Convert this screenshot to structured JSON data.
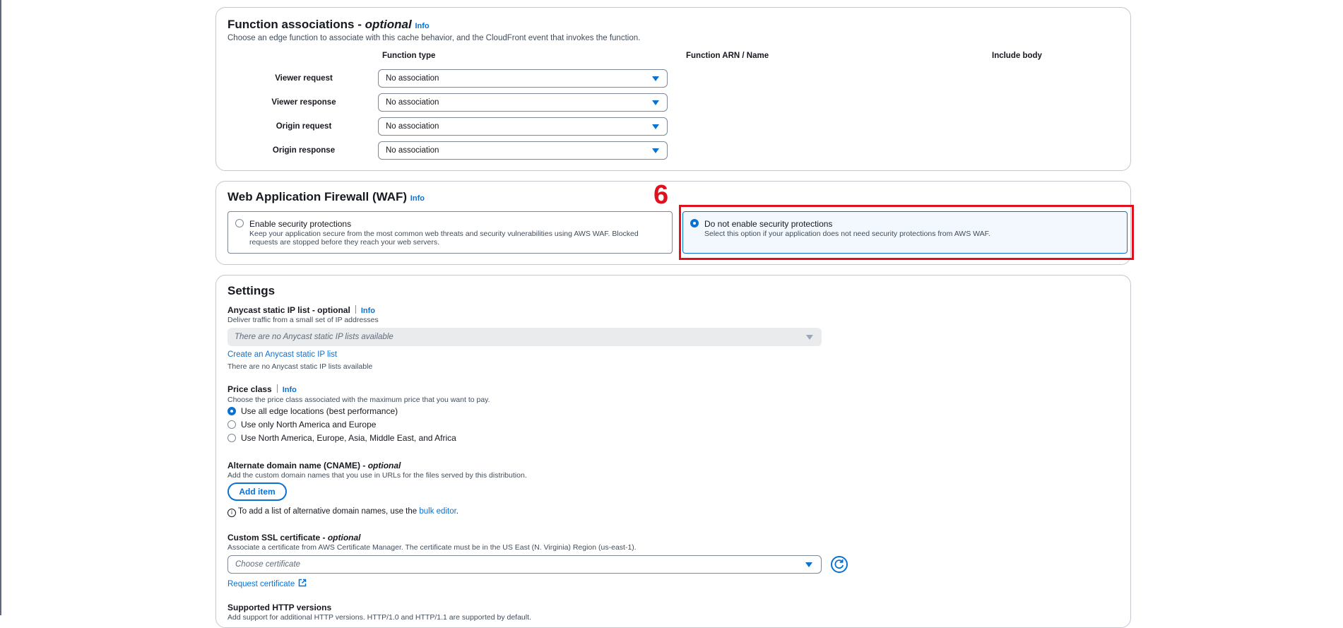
{
  "function_associations": {
    "title": "Function associations -",
    "title_optional": "optional",
    "info": "Info",
    "description": "Choose an edge function to associate with this cache behavior, and the CloudFront event that invokes the function.",
    "col_function_type": "Function type",
    "col_function_arn": "Function ARN / Name",
    "col_include_body": "Include body",
    "rows": [
      {
        "label": "Viewer request",
        "value": "No association"
      },
      {
        "label": "Viewer response",
        "value": "No association"
      },
      {
        "label": "Origin request",
        "value": "No association"
      },
      {
        "label": "Origin response",
        "value": "No association"
      }
    ]
  },
  "waf": {
    "title": "Web Application Firewall (WAF)",
    "info": "Info",
    "options": [
      {
        "title": "Enable security protections",
        "description": "Keep your application secure from the most common web threats and security vulnerabilities using AWS WAF. Blocked requests are stopped before they reach your web servers.",
        "selected": false
      },
      {
        "title": "Do not enable security protections",
        "description": "Select this option if your application does not need security protections from AWS WAF.",
        "selected": true
      }
    ]
  },
  "annotation": {
    "number": "6",
    "color": "#e0111c"
  },
  "settings": {
    "title": "Settings",
    "anycast": {
      "label": "Anycast static IP list - optional",
      "info": "Info",
      "description": "Deliver traffic from a small set of IP addresses",
      "placeholder": "There are no Anycast static IP lists available",
      "create_link": "Create an Anycast static IP list",
      "note": "There are no Anycast static IP lists available"
    },
    "price_class": {
      "label": "Price class",
      "info": "Info",
      "description": "Choose the price class associated with the maximum price that you want to pay.",
      "options": [
        {
          "label": "Use all edge locations (best performance)",
          "selected": true
        },
        {
          "label": "Use only North America and Europe",
          "selected": false
        },
        {
          "label": "Use North America, Europe, Asia, Middle East, and Africa",
          "selected": false
        }
      ]
    },
    "cname": {
      "label": "Alternate domain name (CNAME) -",
      "label_optional": "optional",
      "description": "Add the custom domain names that you use in URLs for the files served by this distribution.",
      "add_button": "Add item",
      "hint_prefix": "To add a list of alternative domain names, use the",
      "hint_link": "bulk editor",
      "hint_suffix": "."
    },
    "ssl": {
      "label": "Custom SSL certificate -",
      "label_optional": "optional",
      "description": "Associate a certificate from AWS Certificate Manager. The certificate must be in the US East (N. Virginia) Region (us-east-1).",
      "placeholder": "Choose certificate",
      "request_link": "Request certificate"
    },
    "http_versions": {
      "label": "Supported HTTP versions",
      "description": "Add support for additional HTTP versions. HTTP/1.0 and HTTP/1.1 are supported by default."
    }
  },
  "colors": {
    "accent": "#0972d3",
    "border": "#c6c6cd",
    "text": "#16191f"
  }
}
